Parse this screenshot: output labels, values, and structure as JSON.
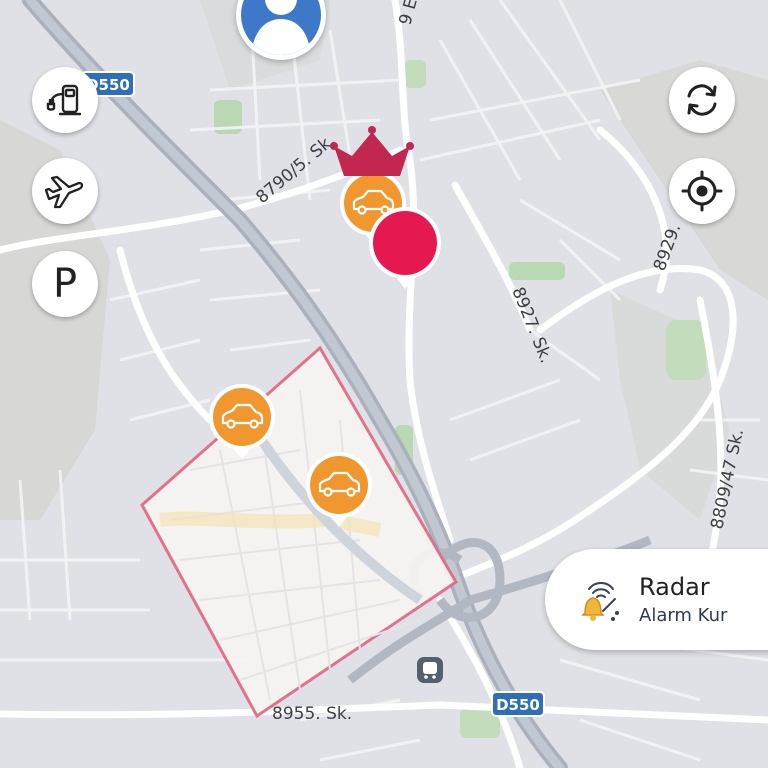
{
  "map": {
    "road_labels": {
      "r1": "8790/5. Sk.",
      "r2": "9 E",
      "r3": "8927. Sk.",
      "r4": "8929.",
      "r5": "8809/47 Sk.",
      "r6": "8955. Sk."
    },
    "shields": {
      "top": "D550",
      "bottom": "D550"
    },
    "colors": {
      "accent_pink": "#e5194f",
      "marker_orange": "#f0982f",
      "zone_border": "#e26a86",
      "crown": "#c2274f",
      "shield_blue": "#2f6fb7"
    }
  },
  "controls": {
    "left": [
      {
        "name": "charging-station-icon"
      },
      {
        "name": "airplane-icon"
      },
      {
        "name": "parking-icon",
        "label": "P"
      }
    ],
    "right": [
      {
        "name": "refresh-icon"
      },
      {
        "name": "locate-me-icon"
      }
    ]
  },
  "radar": {
    "title": "Radar",
    "subtitle": "Alarm Kur",
    "icon": "alarm-bell-radar-icon"
  },
  "markers": {
    "cars": [
      "car-marker",
      "car-marker",
      "car-marker"
    ],
    "crown": "crown-icon",
    "selected_pin": "location-pin",
    "user": "user-avatar-icon",
    "transit": "train-station-icon"
  }
}
